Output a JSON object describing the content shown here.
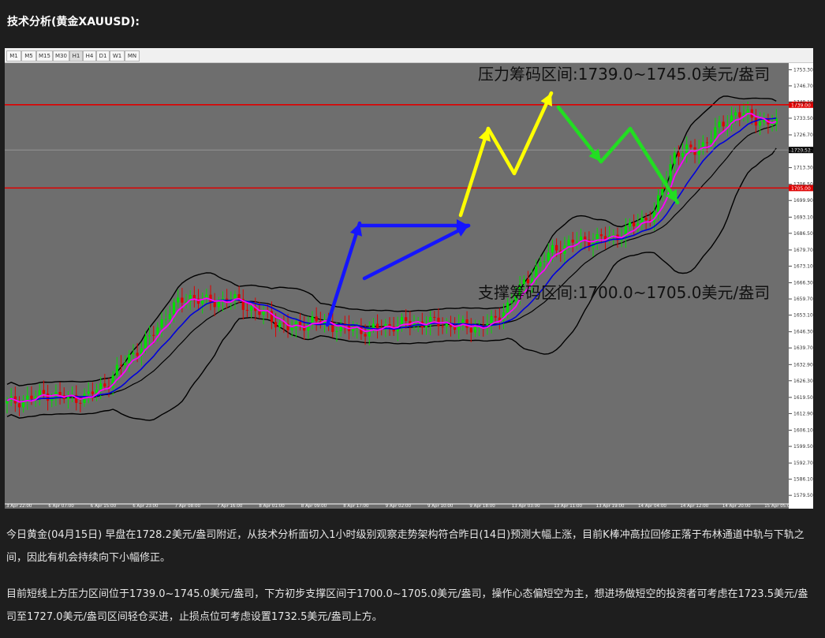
{
  "page": {
    "heading": "技术分析(黄金XAUUSD):",
    "paragraphs": [
      "今日黄金(04月15日) 早盘在1728.2美元/盎司附近，从技术分析面切入1小时级别观察走势架构符合昨日(14日)预测大幅上涨，目前K棒冲高拉回修正落于布林通道中轨与下轨之间，因此有机会持续向下小幅修正。",
      "目前短线上方压力区间位于1739.0~1745.0美元/盎司，下方初步支撑区间于1700.0~1705.0美元/盎司，操作心态偏短空为主，想进场做短空的投资者可考虑在1723.5美元/盎司至1727.0美元/盎司区间轻仓买进，止损点位可考虑设置1732.5美元/盎司上方。"
    ]
  },
  "toolbar": {
    "timeframes": [
      "M1",
      "M5",
      "M15",
      "M30",
      "H1",
      "H4",
      "D1",
      "W1",
      "MN"
    ],
    "active": "H1"
  },
  "chart_data": {
    "type": "candlestick",
    "symbol": "XAUUSD",
    "timeframe": "H1",
    "ylim": [
      1576,
      1756
    ],
    "y_ticks": [
      "1753.30",
      "1746.70",
      "1740.10",
      "1733.50",
      "1726.70",
      "1720.10",
      "1713.30",
      "1706.50",
      "1699.90",
      "1693.10",
      "1686.50",
      "1679.70",
      "1673.10",
      "1666.30",
      "1659.70",
      "1653.10",
      "1646.30",
      "1639.70",
      "1632.90",
      "1626.30",
      "1619.50",
      "1612.90",
      "1606.10",
      "1599.50",
      "1592.70",
      "1586.10",
      "1579.50"
    ],
    "x_ticks": [
      "3 Apr 22:00",
      "6 Apr 07:00",
      "6 Apr 15:00",
      "6 Apr 23:00",
      "7 Apr 08:00",
      "7 Apr 16:00",
      "8 Apr 01:00",
      "8 Apr 09:00",
      "8 Apr 17:00",
      "9 Apr 02:00",
      "9 Apr 10:00",
      "9 Apr 18:00",
      "13 Apr 03:00",
      "13 Apr 11:00",
      "13 Apr 19:00",
      "14 Apr 04:00",
      "14 Apr 12:00",
      "14 Apr 20:00",
      "15 Apr 05:00"
    ],
    "current_price_label": "1720.52",
    "resistance_line": {
      "price": 1739.0,
      "label": "1739.00",
      "color": "#e00000"
    },
    "support_line": {
      "price": 1705.0,
      "label": "1705.00",
      "color": "#e00000"
    },
    "annotations": {
      "resistance": "压力筹码区间:1739.0~1745.0美元/盎司",
      "support": "支撑筹码区间:1700.0~1705.0美元/盎司"
    },
    "close_path": [
      1617,
      1619,
      1621,
      1619,
      1620,
      1626,
      1636,
      1643,
      1655,
      1661,
      1658,
      1660,
      1656,
      1652,
      1647,
      1651,
      1649,
      1647,
      1647,
      1649,
      1650,
      1650,
      1649,
      1648,
      1650,
      1660,
      1671,
      1680,
      1683,
      1684,
      1685,
      1690,
      1695,
      1720,
      1720,
      1728,
      1736,
      1733,
      1731
    ],
    "colors": {
      "bg": "#6e6e6e",
      "up": "#00e000",
      "down": "#e00000",
      "ma_fast": "#ff00ff",
      "ma_slow": "#0000dd",
      "bollinger": "#000000",
      "arrow_blue": "#1515ff",
      "arrow_yellow": "#ffff00",
      "arrow_green": "#22dd22"
    }
  }
}
